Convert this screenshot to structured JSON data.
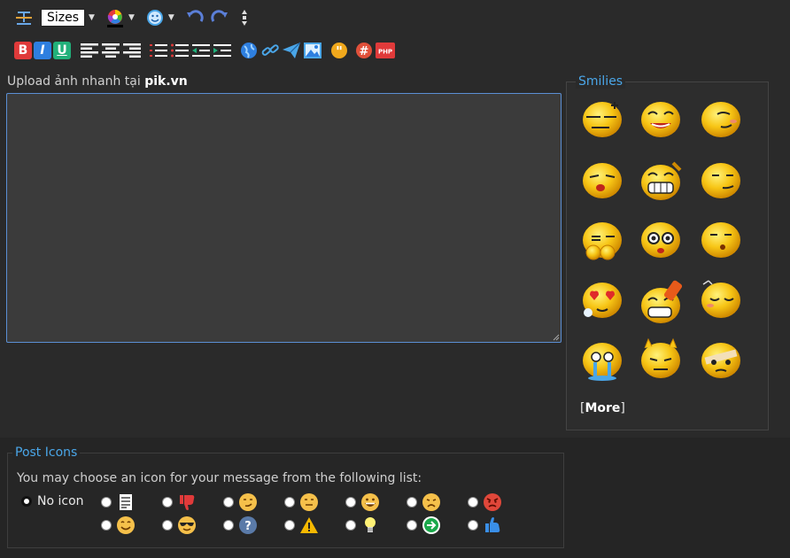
{
  "toolbar": {
    "sizes_label": "Sizes"
  },
  "upload": {
    "prefix": "Upload ảnh nhanh tại ",
    "site": "pik.vn"
  },
  "message": {
    "value": ""
  },
  "smilies": {
    "title": "Smilies",
    "more_open": "[",
    "more_label": "More",
    "more_close": "]"
  },
  "post_icons": {
    "title": "Post Icons",
    "description": "You may choose an icon for your message from the following list:",
    "no_icon_label": "No icon"
  },
  "colors": {
    "accent": "#4aa6e8",
    "editor_border": "#5b8fd4"
  }
}
